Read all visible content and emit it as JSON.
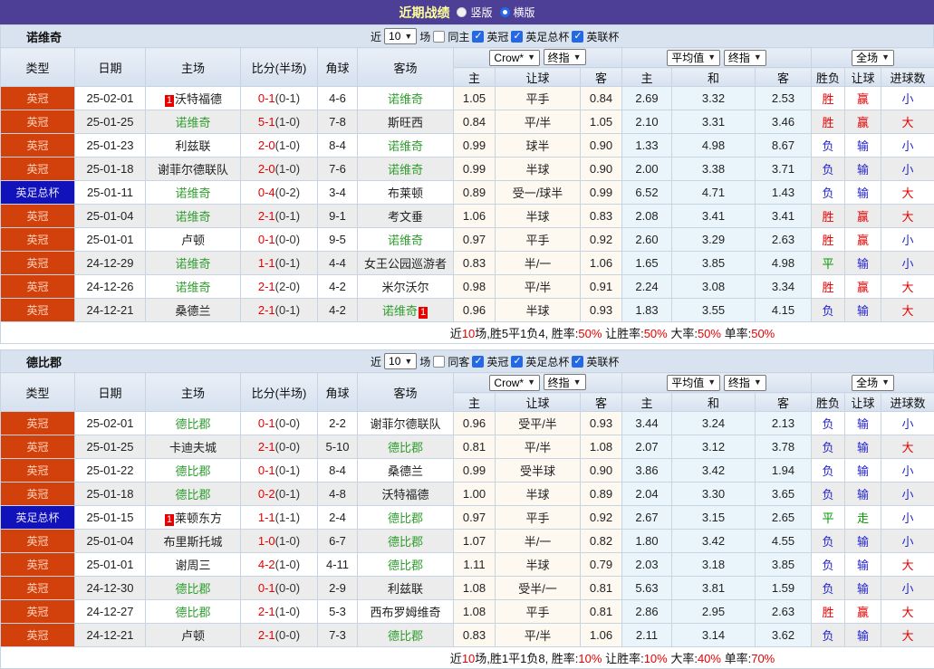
{
  "topbar": {
    "title": "近期战绩",
    "radio_vertical": "竖版",
    "radio_horizontal": "横版",
    "selected_layout": "横版"
  },
  "controls": {
    "near": "近",
    "games": "10",
    "games_suffix": "场",
    "leagues": [
      "英冠",
      "英足总杯",
      "英联杯"
    ],
    "odds_company": "Crow*",
    "final_label": "终指",
    "avg_label": "平均值",
    "final2_label": "终指",
    "scope_label": "全场"
  },
  "columns": {
    "left": [
      "类型",
      "日期",
      "主场",
      "比分(半场)",
      "角球",
      "客场"
    ],
    "odds": [
      "主",
      "让球",
      "客"
    ],
    "avg": [
      "主",
      "和",
      "客"
    ],
    "result": [
      "胜负",
      "让球",
      "进球数"
    ]
  },
  "colors": {
    "topbar_purple": "#4d3e96",
    "title_yellow": "#ffff99",
    "league_red": "#d2410c",
    "league_blue": "#1212bb",
    "team_green": "#2f9e2f",
    "win_red": "#e60000",
    "lose_blue": "#2424cc",
    "draw_green": "#009900",
    "odds_bg": "#fdf8f0",
    "avg_bg": "#eaf5fb",
    "checkbox_blue": "#2469e3"
  },
  "tables": [
    {
      "team": "诺维奇",
      "same_label": "同主",
      "rows": [
        {
          "lg": "英冠",
          "lgc": "red",
          "date": "25-02-01",
          "home": "沃特福德",
          "homec": "",
          "hb": "1",
          "score": "0-1",
          "half": "(0-1)",
          "corner": "4-6",
          "away": "诺维奇",
          "awayc": "green",
          "ab": "",
          "odds": [
            "1.05",
            "平手",
            "0.84"
          ],
          "avg": [
            "2.69",
            "3.32",
            "2.53"
          ],
          "res": [
            "胜",
            "red"
          ],
          "hres": [
            "赢",
            "red"
          ],
          "goal": [
            "小",
            "blue"
          ]
        },
        {
          "lg": "英冠",
          "lgc": "red",
          "date": "25-01-25",
          "home": "诺维奇",
          "homec": "green",
          "hb": "",
          "score": "5-1",
          "half": "(1-0)",
          "corner": "7-8",
          "away": "斯旺西",
          "awayc": "",
          "ab": "",
          "odds": [
            "0.84",
            "平/半",
            "1.05"
          ],
          "avg": [
            "2.10",
            "3.31",
            "3.46"
          ],
          "res": [
            "胜",
            "red"
          ],
          "hres": [
            "赢",
            "red"
          ],
          "goal": [
            "大",
            "red"
          ]
        },
        {
          "lg": "英冠",
          "lgc": "red",
          "date": "25-01-23",
          "home": "利兹联",
          "homec": "",
          "hb": "",
          "score": "2-0",
          "half": "(1-0)",
          "corner": "8-4",
          "away": "诺维奇",
          "awayc": "green",
          "ab": "",
          "odds": [
            "0.99",
            "球半",
            "0.90"
          ],
          "avg": [
            "1.33",
            "4.98",
            "8.67"
          ],
          "res": [
            "负",
            "blue"
          ],
          "hres": [
            "输",
            "blue"
          ],
          "goal": [
            "小",
            "blue"
          ]
        },
        {
          "lg": "英冠",
          "lgc": "red",
          "date": "25-01-18",
          "home": "谢菲尔德联队",
          "homec": "",
          "hb": "",
          "score": "2-0",
          "half": "(1-0)",
          "corner": "7-6",
          "away": "诺维奇",
          "awayc": "green",
          "ab": "",
          "odds": [
            "0.99",
            "半球",
            "0.90"
          ],
          "avg": [
            "2.00",
            "3.38",
            "3.71"
          ],
          "res": [
            "负",
            "blue"
          ],
          "hres": [
            "输",
            "blue"
          ],
          "goal": [
            "小",
            "blue"
          ]
        },
        {
          "lg": "英足总杯",
          "lgc": "blue",
          "date": "25-01-11",
          "home": "诺维奇",
          "homec": "green",
          "hb": "",
          "score": "0-4",
          "half": "(0-2)",
          "corner": "3-4",
          "away": "布莱顿",
          "awayc": "",
          "ab": "",
          "odds": [
            "0.89",
            "受一/球半",
            "0.99"
          ],
          "avg": [
            "6.52",
            "4.71",
            "1.43"
          ],
          "res": [
            "负",
            "blue"
          ],
          "hres": [
            "输",
            "blue"
          ],
          "goal": [
            "大",
            "red"
          ]
        },
        {
          "lg": "英冠",
          "lgc": "red",
          "date": "25-01-04",
          "home": "诺维奇",
          "homec": "green",
          "hb": "",
          "score": "2-1",
          "half": "(0-1)",
          "corner": "9-1",
          "away": "考文垂",
          "awayc": "",
          "ab": "",
          "odds": [
            "1.06",
            "半球",
            "0.83"
          ],
          "avg": [
            "2.08",
            "3.41",
            "3.41"
          ],
          "res": [
            "胜",
            "red"
          ],
          "hres": [
            "赢",
            "red"
          ],
          "goal": [
            "大",
            "red"
          ]
        },
        {
          "lg": "英冠",
          "lgc": "red",
          "date": "25-01-01",
          "home": "卢顿",
          "homec": "",
          "hb": "",
          "score": "0-1",
          "half": "(0-0)",
          "corner": "9-5",
          "away": "诺维奇",
          "awayc": "green",
          "ab": "",
          "odds": [
            "0.97",
            "平手",
            "0.92"
          ],
          "avg": [
            "2.60",
            "3.29",
            "2.63"
          ],
          "res": [
            "胜",
            "red"
          ],
          "hres": [
            "赢",
            "red"
          ],
          "goal": [
            "小",
            "blue"
          ]
        },
        {
          "lg": "英冠",
          "lgc": "red",
          "date": "24-12-29",
          "home": "诺维奇",
          "homec": "green",
          "hb": "",
          "score": "1-1",
          "half": "(0-1)",
          "corner": "4-4",
          "away": "女王公园巡游者",
          "awayc": "",
          "ab": "",
          "odds": [
            "0.83",
            "半/一",
            "1.06"
          ],
          "avg": [
            "1.65",
            "3.85",
            "4.98"
          ],
          "res": [
            "平",
            "green"
          ],
          "hres": [
            "输",
            "blue"
          ],
          "goal": [
            "小",
            "blue"
          ]
        },
        {
          "lg": "英冠",
          "lgc": "red",
          "date": "24-12-26",
          "home": "诺维奇",
          "homec": "green",
          "hb": "",
          "score": "2-1",
          "half": "(2-0)",
          "corner": "4-2",
          "away": "米尔沃尔",
          "awayc": "",
          "ab": "",
          "odds": [
            "0.98",
            "平/半",
            "0.91"
          ],
          "avg": [
            "2.24",
            "3.08",
            "3.34"
          ],
          "res": [
            "胜",
            "red"
          ],
          "hres": [
            "赢",
            "red"
          ],
          "goal": [
            "大",
            "red"
          ]
        },
        {
          "lg": "英冠",
          "lgc": "red",
          "date": "24-12-21",
          "home": "桑德兰",
          "homec": "",
          "hb": "",
          "score": "2-1",
          "half": "(0-1)",
          "corner": "4-2",
          "away": "诺维奇",
          "awayc": "green",
          "ab": "1",
          "odds": [
            "0.96",
            "半球",
            "0.93"
          ],
          "avg": [
            "1.83",
            "3.55",
            "4.15"
          ],
          "res": [
            "负",
            "blue"
          ],
          "hres": [
            "输",
            "blue"
          ],
          "goal": [
            "大",
            "red"
          ]
        }
      ],
      "summary": [
        {
          "t": "近"
        },
        {
          "t": "10",
          "r": true
        },
        {
          "t": "场,胜5平1负4, 胜率:"
        },
        {
          "t": "50%",
          "r": true
        },
        {
          "t": " 让胜率:"
        },
        {
          "t": "50%",
          "r": true
        },
        {
          "t": " 大率:"
        },
        {
          "t": "50%",
          "r": true
        },
        {
          "t": " 单率:"
        },
        {
          "t": "50%",
          "r": true
        }
      ]
    },
    {
      "team": "德比郡",
      "same_label": "同客",
      "rows": [
        {
          "lg": "英冠",
          "lgc": "red",
          "date": "25-02-01",
          "home": "德比郡",
          "homec": "green",
          "hb": "",
          "score": "0-1",
          "half": "(0-0)",
          "corner": "2-2",
          "away": "谢菲尔德联队",
          "awayc": "",
          "ab": "",
          "odds": [
            "0.96",
            "受平/半",
            "0.93"
          ],
          "avg": [
            "3.44",
            "3.24",
            "2.13"
          ],
          "res": [
            "负",
            "blue"
          ],
          "hres": [
            "输",
            "blue"
          ],
          "goal": [
            "小",
            "blue"
          ]
        },
        {
          "lg": "英冠",
          "lgc": "red",
          "date": "25-01-25",
          "home": "卡迪夫城",
          "homec": "",
          "hb": "",
          "score": "2-1",
          "half": "(0-0)",
          "corner": "5-10",
          "away": "德比郡",
          "awayc": "green",
          "ab": "",
          "odds": [
            "0.81",
            "平/半",
            "1.08"
          ],
          "avg": [
            "2.07",
            "3.12",
            "3.78"
          ],
          "res": [
            "负",
            "blue"
          ],
          "hres": [
            "输",
            "blue"
          ],
          "goal": [
            "大",
            "red"
          ]
        },
        {
          "lg": "英冠",
          "lgc": "red",
          "date": "25-01-22",
          "home": "德比郡",
          "homec": "green",
          "hb": "",
          "score": "0-1",
          "half": "(0-1)",
          "corner": "8-4",
          "away": "桑德兰",
          "awayc": "",
          "ab": "",
          "odds": [
            "0.99",
            "受半球",
            "0.90"
          ],
          "avg": [
            "3.86",
            "3.42",
            "1.94"
          ],
          "res": [
            "负",
            "blue"
          ],
          "hres": [
            "输",
            "blue"
          ],
          "goal": [
            "小",
            "blue"
          ]
        },
        {
          "lg": "英冠",
          "lgc": "red",
          "date": "25-01-18",
          "home": "德比郡",
          "homec": "green",
          "hb": "",
          "score": "0-2",
          "half": "(0-1)",
          "corner": "4-8",
          "away": "沃特福德",
          "awayc": "",
          "ab": "",
          "odds": [
            "1.00",
            "半球",
            "0.89"
          ],
          "avg": [
            "2.04",
            "3.30",
            "3.65"
          ],
          "res": [
            "负",
            "blue"
          ],
          "hres": [
            "输",
            "blue"
          ],
          "goal": [
            "小",
            "blue"
          ]
        },
        {
          "lg": "英足总杯",
          "lgc": "blue",
          "date": "25-01-15",
          "home": "莱顿东方",
          "homec": "",
          "hb": "1",
          "score": "1-1",
          "half": "(1-1)",
          "corner": "2-4",
          "away": "德比郡",
          "awayc": "green",
          "ab": "",
          "odds": [
            "0.97",
            "平手",
            "0.92"
          ],
          "avg": [
            "2.67",
            "3.15",
            "2.65"
          ],
          "res": [
            "平",
            "green"
          ],
          "hres": [
            "走",
            "green"
          ],
          "goal": [
            "小",
            "blue"
          ]
        },
        {
          "lg": "英冠",
          "lgc": "red",
          "date": "25-01-04",
          "home": "布里斯托城",
          "homec": "",
          "hb": "",
          "score": "1-0",
          "half": "(1-0)",
          "corner": "6-7",
          "away": "德比郡",
          "awayc": "green",
          "ab": "",
          "odds": [
            "1.07",
            "半/一",
            "0.82"
          ],
          "avg": [
            "1.80",
            "3.42",
            "4.55"
          ],
          "res": [
            "负",
            "blue"
          ],
          "hres": [
            "输",
            "blue"
          ],
          "goal": [
            "小",
            "blue"
          ]
        },
        {
          "lg": "英冠",
          "lgc": "red",
          "date": "25-01-01",
          "home": "谢周三",
          "homec": "",
          "hb": "",
          "score": "4-2",
          "half": "(1-0)",
          "corner": "4-11",
          "away": "德比郡",
          "awayc": "green",
          "ab": "",
          "odds": [
            "1.11",
            "半球",
            "0.79"
          ],
          "avg": [
            "2.03",
            "3.18",
            "3.85"
          ],
          "res": [
            "负",
            "blue"
          ],
          "hres": [
            "输",
            "blue"
          ],
          "goal": [
            "大",
            "red"
          ]
        },
        {
          "lg": "英冠",
          "lgc": "red",
          "date": "24-12-30",
          "home": "德比郡",
          "homec": "green",
          "hb": "",
          "score": "0-1",
          "half": "(0-0)",
          "corner": "2-9",
          "away": "利兹联",
          "awayc": "",
          "ab": "",
          "odds": [
            "1.08",
            "受半/一",
            "0.81"
          ],
          "avg": [
            "5.63",
            "3.81",
            "1.59"
          ],
          "res": [
            "负",
            "blue"
          ],
          "hres": [
            "输",
            "blue"
          ],
          "goal": [
            "小",
            "blue"
          ]
        },
        {
          "lg": "英冠",
          "lgc": "red",
          "date": "24-12-27",
          "home": "德比郡",
          "homec": "green",
          "hb": "",
          "score": "2-1",
          "half": "(1-0)",
          "corner": "5-3",
          "away": "西布罗姆维奇",
          "awayc": "",
          "ab": "",
          "odds": [
            "1.08",
            "平手",
            "0.81"
          ],
          "avg": [
            "2.86",
            "2.95",
            "2.63"
          ],
          "res": [
            "胜",
            "red"
          ],
          "hres": [
            "赢",
            "red"
          ],
          "goal": [
            "大",
            "red"
          ]
        },
        {
          "lg": "英冠",
          "lgc": "red",
          "date": "24-12-21",
          "home": "卢顿",
          "homec": "",
          "hb": "",
          "score": "2-1",
          "half": "(0-0)",
          "corner": "7-3",
          "away": "德比郡",
          "awayc": "green",
          "ab": "",
          "odds": [
            "0.83",
            "平/半",
            "1.06"
          ],
          "avg": [
            "2.11",
            "3.14",
            "3.62"
          ],
          "res": [
            "负",
            "blue"
          ],
          "hres": [
            "输",
            "blue"
          ],
          "goal": [
            "大",
            "red"
          ]
        }
      ],
      "summary": [
        {
          "t": "近"
        },
        {
          "t": "10",
          "r": true
        },
        {
          "t": "场,胜1平1负8, 胜率:"
        },
        {
          "t": "10%",
          "r": true
        },
        {
          "t": " 让胜率:"
        },
        {
          "t": "10%",
          "r": true
        },
        {
          "t": " 大率:"
        },
        {
          "t": "40%",
          "r": true
        },
        {
          "t": " 单率:"
        },
        {
          "t": "70%",
          "r": true
        }
      ]
    }
  ]
}
